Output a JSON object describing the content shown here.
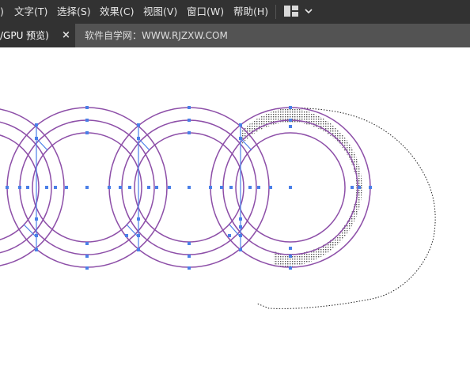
{
  "menubar": {
    "items": [
      {
        "label": ")"
      },
      {
        "label": "文字(T)"
      },
      {
        "label": "选择(S)"
      },
      {
        "label": "效果(C)"
      },
      {
        "label": "视图(V)"
      },
      {
        "label": "窗口(W)"
      },
      {
        "label": "帮助(H)"
      }
    ],
    "layout_icon": "workspace-layout-icon",
    "chevron": "⌄"
  },
  "tabs": {
    "active": {
      "label": "/GPU 预览)",
      "close": "×"
    },
    "inactive": {
      "label": "软件自学网：WWW.RJZXW.COM"
    }
  },
  "colors": {
    "menubar_bg": "#323232",
    "tabbar_bg": "#535353",
    "path_stroke": "#8d4fa8",
    "anchor": "#4a7fe8"
  }
}
